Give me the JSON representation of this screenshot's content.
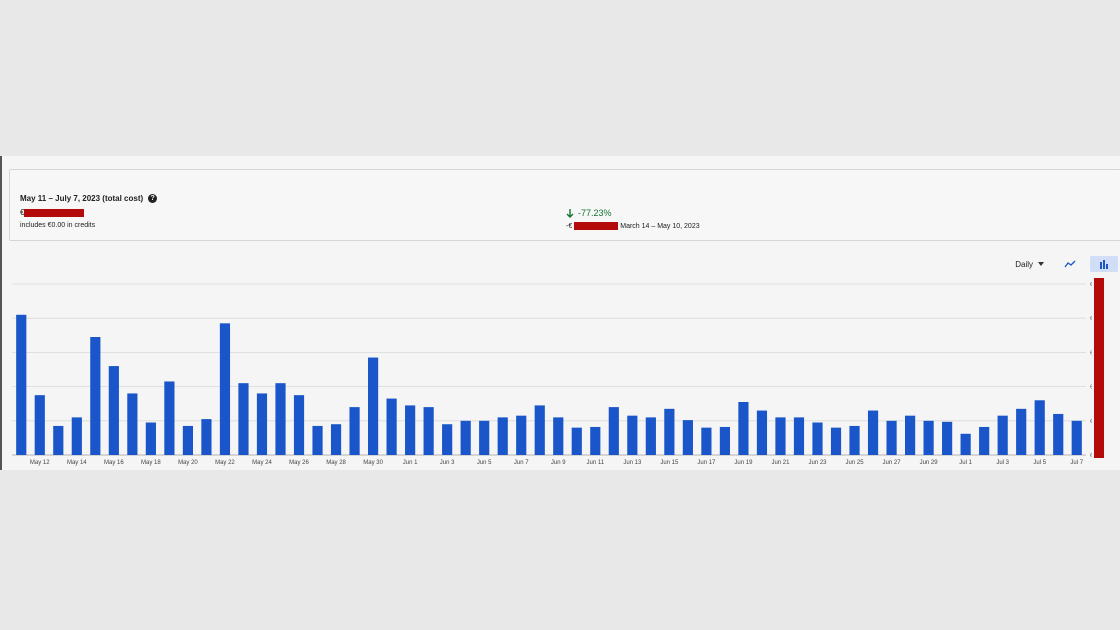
{
  "summary": {
    "title": "May 11 – July 7, 2023 (total cost)",
    "total_prefix": "€",
    "credits_text": "includes €0.00 in credits",
    "change_text": "-77.23%",
    "compare_prefix": "-€",
    "compare_range": "March 14 – May 10, 2023"
  },
  "controls": {
    "period_label": "Daily",
    "line_icon": "line-chart-icon",
    "bar_icon": "bar-chart-icon"
  },
  "colors": {
    "bar": "#1a56c9",
    "grid": "#d9d9d9",
    "redaction": "#b40a0a",
    "positive_change": "#137333"
  },
  "chart_data": {
    "type": "bar",
    "y_tick_labels": [
      "€",
      "€",
      "€",
      "€",
      "€",
      "€"
    ],
    "x_tick_labels": [
      "May 12",
      "May 14",
      "May 16",
      "May 18",
      "May 20",
      "May 22",
      "May 24",
      "May 26",
      "May 28",
      "May 30",
      "Jun 1",
      "Jun 3",
      "Jun 5",
      "Jun 7",
      "Jun 9",
      "Jun 11",
      "Jun 13",
      "Jun 15",
      "Jun 17",
      "Jun 19",
      "Jun 21",
      "Jun 23",
      "Jun 25",
      "Jun 27",
      "Jun 29",
      "Jul 1",
      "Jul 3",
      "Jul 5",
      "Jul 7"
    ],
    "categories": [
      "May 11",
      "May 12",
      "May 13",
      "May 14",
      "May 15",
      "May 16",
      "May 17",
      "May 18",
      "May 19",
      "May 20",
      "May 21",
      "May 22",
      "May 23",
      "May 24",
      "May 25",
      "May 26",
      "May 27",
      "May 28",
      "May 29",
      "May 30",
      "May 31",
      "Jun 1",
      "Jun 2",
      "Jun 3",
      "Jun 4",
      "Jun 5",
      "Jun 6",
      "Jun 7",
      "Jun 8",
      "Jun 9",
      "Jun 10",
      "Jun 11",
      "Jun 12",
      "Jun 13",
      "Jun 14",
      "Jun 15",
      "Jun 16",
      "Jun 17",
      "Jun 18",
      "Jun 19",
      "Jun 20",
      "Jun 21",
      "Jun 22",
      "Jun 23",
      "Jun 24",
      "Jun 25",
      "Jun 26",
      "Jun 27",
      "Jun 28",
      "Jun 29",
      "Jun 30",
      "Jul 1",
      "Jul 2",
      "Jul 3",
      "Jul 4",
      "Jul 5",
      "Jul 6",
      "Jul 7"
    ],
    "values": [
      4.1,
      1.75,
      0.85,
      1.1,
      3.45,
      2.6,
      1.8,
      0.95,
      2.15,
      0.85,
      1.05,
      3.85,
      2.1,
      1.8,
      2.1,
      1.75,
      0.85,
      0.9,
      1.4,
      2.85,
      1.65,
      1.45,
      1.4,
      0.9,
      1.0,
      1.0,
      1.1,
      1.15,
      1.45,
      1.1,
      0.8,
      0.82,
      1.4,
      1.15,
      1.1,
      1.35,
      1.02,
      0.8,
      0.82,
      1.55,
      1.3,
      1.1,
      1.1,
      0.95,
      0.8,
      0.85,
      1.3,
      1.0,
      1.15,
      1.0,
      0.97,
      0.62,
      0.82,
      1.15,
      1.35,
      1.6,
      1.2,
      1.0
    ],
    "ylim": [
      0,
      5
    ]
  }
}
